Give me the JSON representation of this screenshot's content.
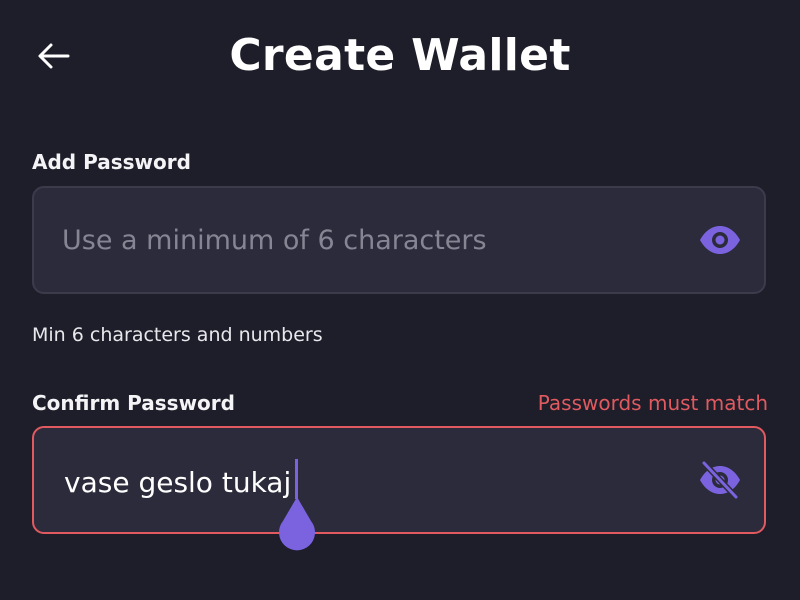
{
  "header": {
    "title": "Create Wallet",
    "back_icon": "arrow-left-icon"
  },
  "password": {
    "label": "Add Password",
    "placeholder": "Use a minimum of 6 characters",
    "value": "",
    "toggle_icon": "eye-icon",
    "hint": "Min 6 characters and numbers"
  },
  "confirm": {
    "label": "Confirm Password",
    "value": "vase geslo tukaj",
    "error": "Passwords must match",
    "toggle_icon": "eye-off-icon"
  },
  "colors": {
    "background": "#1e1e2a",
    "field": "#2c2b3b",
    "accent": "#7b63e0",
    "error": "#e05a5f"
  }
}
